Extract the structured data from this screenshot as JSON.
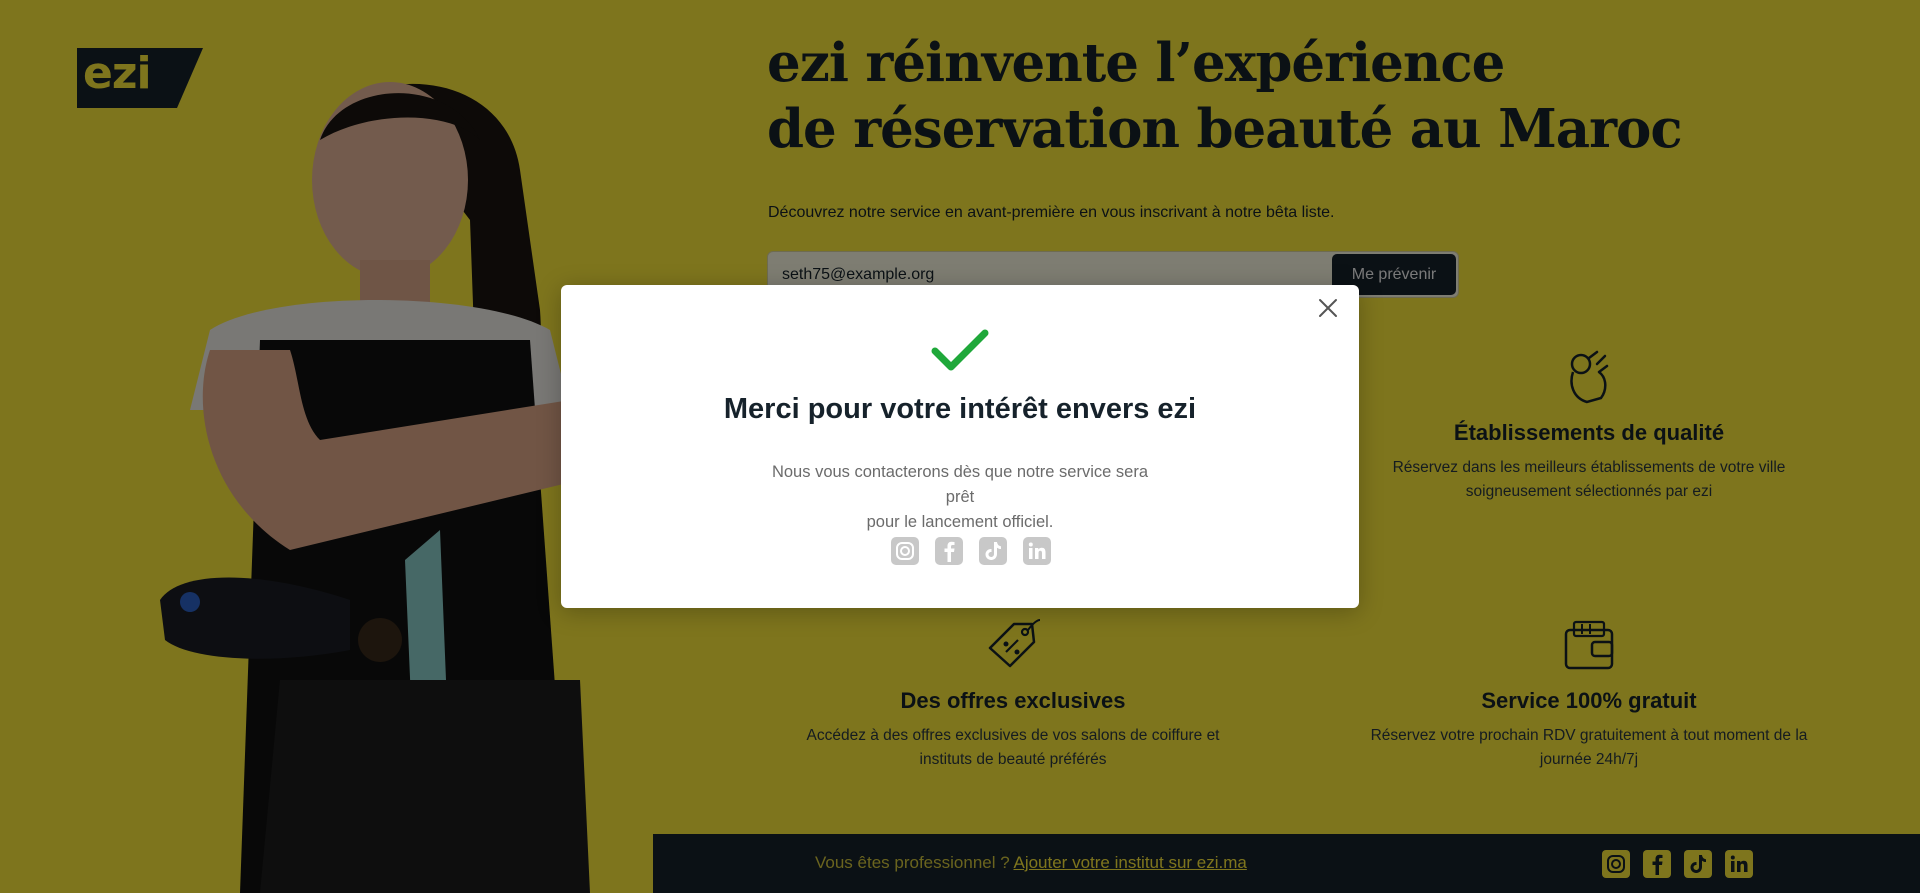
{
  "brand": {
    "logo_text": "ezi",
    "accent": "#fdea3a",
    "dark": "#16222b",
    "success": "#1fa83a"
  },
  "hero": {
    "headline_line1": "ezi réinvente l’expérience",
    "headline_line2": "de réservation beauté au Maroc",
    "intro": "Découvrez notre service en avant-première en vous inscrivant à notre bêta liste."
  },
  "signup": {
    "email_value": "seth75@example.org",
    "button_label": "Me prévenir"
  },
  "features": [
    {
      "icon": "ok-hand-icon",
      "title": "Établissements de qualité",
      "desc_line1": "Réservez dans les meilleurs établissements de votre ville",
      "desc_line2": "soigneusement sélectionnés par ezi"
    },
    {
      "icon": "price-tag-icon",
      "title": "Des offres exclusives",
      "desc_line1": "Accédez à des offres exclusives de vos salons de coiffure et",
      "desc_line2": "instituts de beauté préférés"
    },
    {
      "icon": "wallet-icon",
      "title": "Service 100% gratuit",
      "desc_line1": "Réservez votre prochain RDV gratuitement à tout moment de la",
      "desc_line2": "journée 24h/7j"
    }
  ],
  "footer": {
    "text": "Vous êtes professionnel ? ",
    "link": "Ajouter votre institut sur ezi.ma",
    "social": [
      "instagram-icon",
      "facebook-icon",
      "tiktok-icon",
      "linkedin-icon"
    ]
  },
  "modal": {
    "title": "Merci pour votre intérêt envers ezi",
    "text_line1": "Nous vous contacterons dès que notre service sera prêt",
    "text_line2": "pour le lancement officiel.",
    "social": [
      "instagram-icon",
      "facebook-icon",
      "tiktok-icon",
      "linkedin-icon"
    ]
  }
}
